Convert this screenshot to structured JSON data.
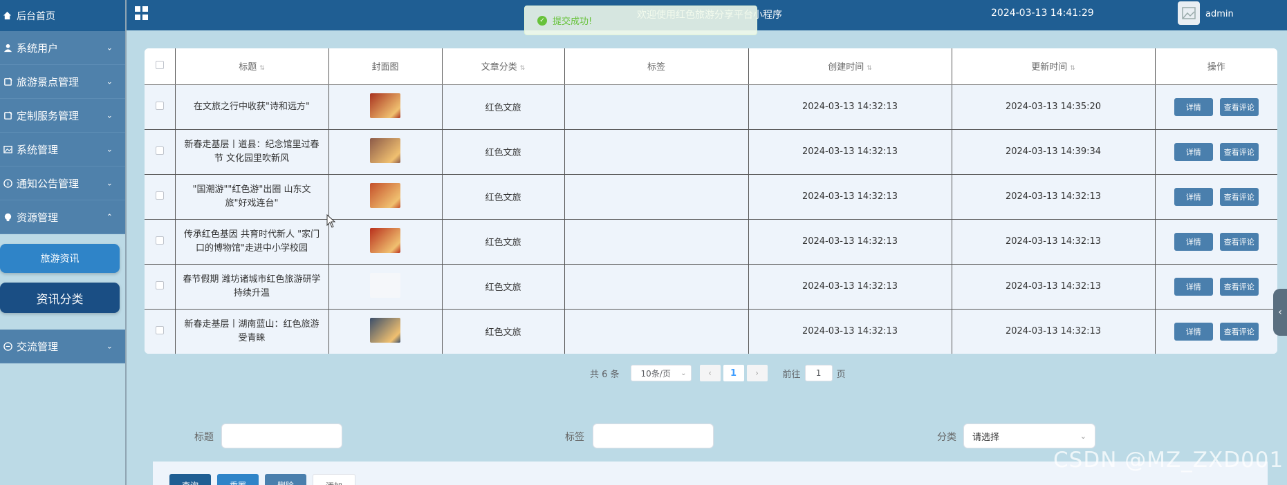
{
  "sidebar": {
    "home": "后台首页",
    "items": [
      {
        "label": "系统用户",
        "icon": "user-icon"
      },
      {
        "label": "旅游景点管理",
        "icon": "doc-icon"
      },
      {
        "label": "定制服务管理",
        "icon": "doc-icon"
      },
      {
        "label": "系统管理",
        "icon": "image-icon"
      },
      {
        "label": "通知公告管理",
        "icon": "info-icon"
      },
      {
        "label": "资源管理",
        "icon": "bulb-icon"
      },
      {
        "label": "交流管理",
        "icon": "chat-icon"
      }
    ],
    "sub": [
      "旅游资讯",
      "资讯分类"
    ]
  },
  "header": {
    "title": "欢迎使用红色旅游分享平台小程序",
    "time": "2024-03-13 14:41:29",
    "user": "admin"
  },
  "toast": "提交成功!",
  "table": {
    "headers": [
      "标题",
      "封面图",
      "文章分类",
      "标签",
      "创建时间",
      "更新时间",
      "操作"
    ],
    "rows": [
      {
        "title": "在文旅之行中收获\"诗和远方\"",
        "category": "红色文旅",
        "tag": "",
        "created": "2024-03-13 14:32:13",
        "updated": "2024-03-13 14:35:20",
        "thumb": "#a8321f"
      },
      {
        "title": "新春走基层丨道县：纪念馆里过春节 文化园里吹新风",
        "category": "红色文旅",
        "tag": "",
        "created": "2024-03-13 14:32:13",
        "updated": "2024-03-13 14:39:34",
        "thumb": "#8c5a48"
      },
      {
        "title": "\"国潮游\"\"红色游\"出圈 山东文旅\"好戏连台\"",
        "category": "红色文旅",
        "tag": "",
        "created": "2024-03-13 14:32:13",
        "updated": "2024-03-13 14:32:13",
        "thumb": "#c4502a"
      },
      {
        "title": "传承红色基因 共育时代新人 \"家门口的博物馆\"走进中小学校园",
        "category": "红色文旅",
        "tag": "",
        "created": "2024-03-13 14:32:13",
        "updated": "2024-03-13 14:32:13",
        "thumb": "#b8301c"
      },
      {
        "title": "春节假期 潍坊诸城市红色旅游研学持续升温",
        "category": "红色文旅",
        "tag": "",
        "created": "2024-03-13 14:32:13",
        "updated": "2024-03-13 14:32:13",
        "thumb": ""
      },
      {
        "title": "新春走基层丨湖南蓝山：红色旅游受青睐",
        "category": "红色文旅",
        "tag": "",
        "created": "2024-03-13 14:32:13",
        "updated": "2024-03-13 14:32:13",
        "thumb": "#3a4e6a"
      }
    ],
    "detail_label": "详情",
    "comment_label": "查看评论"
  },
  "pager": {
    "total": "共 6 条",
    "size": "10条/页",
    "current": "1",
    "goto_prefix": "前往",
    "goto_value": "1",
    "goto_suffix": "页"
  },
  "search": {
    "title_label": "标题",
    "tag_label": "标签",
    "category_label": "分类",
    "category_placeholder": "请选择"
  },
  "actions": {
    "query": "查询",
    "reset": "重置",
    "delete": "删除",
    "add": "添加"
  },
  "watermark": "CSDN @MZ_ZXD001"
}
